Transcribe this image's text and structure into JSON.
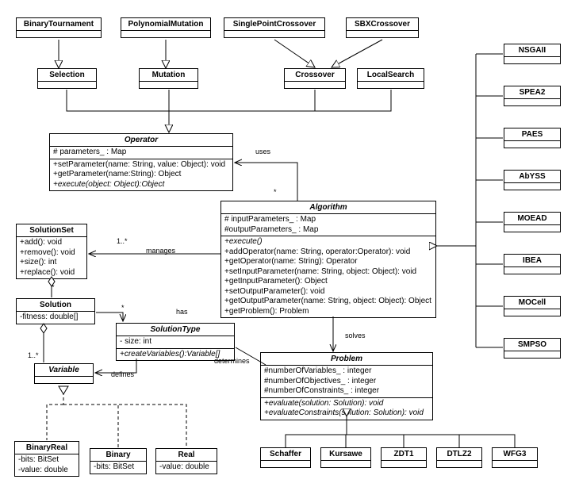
{
  "classes": {
    "BinaryTournament": {
      "title": "BinaryTournament"
    },
    "PolynomialMutation": {
      "title": "PolynomialMutation"
    },
    "SinglePointCrossover": {
      "title": "SinglePointCrossover"
    },
    "SBXCrossover": {
      "title": "SBXCrossover"
    },
    "Selection": {
      "title": "Selection"
    },
    "Mutation": {
      "title": "Mutation"
    },
    "Crossover": {
      "title": "Crossover"
    },
    "LocalSearch": {
      "title": "LocalSearch"
    },
    "Operator": {
      "title": "Operator",
      "attrs": [
        "# parameters_ : Map"
      ],
      "ops": [
        "+setParameter(name: String, value: Object): void",
        "+getParameter(name:String): Object",
        "+execute(object: Object):Object"
      ]
    },
    "Algorithm": {
      "title": "Algorithm",
      "attrs": [
        "# inputParameters_ : Map",
        "#outputParameters_ : Map"
      ],
      "ops": [
        "+execute()",
        "+addOperator(name: String, operator:Operator): void",
        "+getOperator(name: String): Operator",
        "+setInputParameter(name: String, object: Object): void",
        "+getInputParameter(): Object",
        "+setOutputParameter(): void",
        "+getOutputParameter(name: String, object: Object): Object",
        "+getProblem(): Problem"
      ]
    },
    "SolutionSet": {
      "title": "SolutionSet",
      "ops": [
        "+add(): void",
        "+remove(): void",
        "+size(): int",
        "+replace(): void"
      ]
    },
    "Solution": {
      "title": "Solution",
      "attrs": [
        "-fitness: double[]"
      ]
    },
    "SolutionType": {
      "title": "SolutionType",
      "attrs": [
        "- size: int"
      ],
      "ops": [
        "+createVariables():Variable[]"
      ]
    },
    "Variable": {
      "title": "Variable"
    },
    "Problem": {
      "title": "Problem",
      "attrs": [
        "#numberOfVariables_ : integer",
        "#numberOfObjectives_ : integer",
        "#numberOfConstraints_ : integer"
      ],
      "ops": [
        "+evaluate(solution: Solution): void",
        "+evaluateConstraints(solution: Solution): void"
      ]
    },
    "BinaryReal": {
      "title": "BinaryReal",
      "attrs": [
        "-bits: BitSet",
        "-value: double"
      ]
    },
    "Binary": {
      "title": "Binary",
      "attrs": [
        "-bits: BitSet"
      ]
    },
    "Real": {
      "title": "Real",
      "attrs": [
        "-value: double"
      ]
    },
    "Schaffer": {
      "title": "Schaffer"
    },
    "Kursawe": {
      "title": "Kursawe"
    },
    "ZDT1": {
      "title": "ZDT1"
    },
    "DTLZ2": {
      "title": "DTLZ2"
    },
    "WFG3": {
      "title": "WFG3"
    },
    "NSGAII": {
      "title": "NSGAII"
    },
    "SPEA2": {
      "title": "SPEA2"
    },
    "PAES": {
      "title": "PAES"
    },
    "AbYSS": {
      "title": "AbYSS"
    },
    "MOEAD": {
      "title": "MOEAD"
    },
    "IBEA": {
      "title": "IBEA"
    },
    "MOCell": {
      "title": "MOCell"
    },
    "SMPSO": {
      "title": "SMPSO"
    }
  },
  "labels": {
    "uses": "uses",
    "manages": "manages",
    "has": "has",
    "defines": "defines",
    "determines": "determines",
    "solves": "solves",
    "star1": "*",
    "star2": "*",
    "star3": "*",
    "m1": "1..*",
    "m2": "1..*"
  }
}
